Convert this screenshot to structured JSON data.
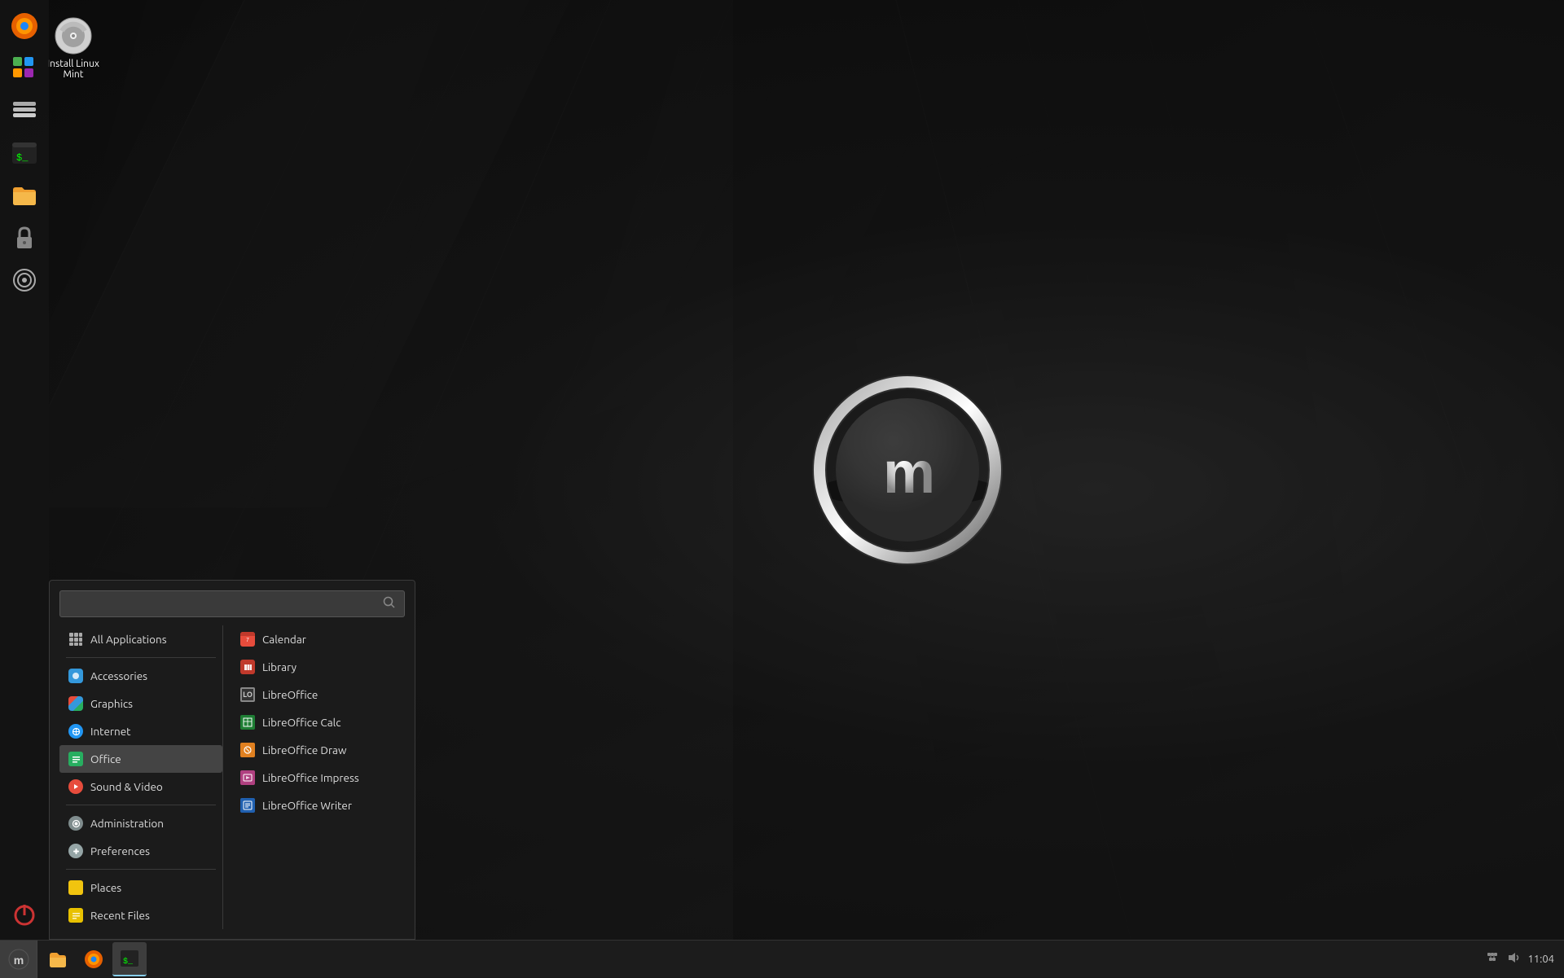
{
  "desktop": {
    "icon": {
      "label": "Install Linux Mint"
    }
  },
  "taskbar": {
    "time": "11:04",
    "start_label": "☰",
    "apps": [
      {
        "name": "files",
        "icon": "📁"
      },
      {
        "name": "firefox",
        "icon": "🦊"
      },
      {
        "name": "terminal",
        "icon": "⬛"
      }
    ]
  },
  "sidebar": {
    "icons": [
      {
        "name": "firefox",
        "icon": "🦊"
      },
      {
        "name": "grid-app",
        "icon": "⬛"
      },
      {
        "name": "stack",
        "icon": "⬛"
      },
      {
        "name": "terminal",
        "icon": "⬛"
      },
      {
        "name": "folder",
        "icon": "📁"
      },
      {
        "name": "lock",
        "icon": "🔒"
      },
      {
        "name": "gyro",
        "icon": "⬛"
      },
      {
        "name": "power",
        "icon": "⬛"
      }
    ]
  },
  "start_menu": {
    "search_placeholder": "",
    "left_items": [
      {
        "id": "all-apps",
        "label": "All Applications",
        "icon_type": "grid"
      },
      {
        "id": "accessories",
        "label": "Accessories",
        "icon_type": "blue"
      },
      {
        "id": "graphics",
        "label": "Graphics",
        "icon_type": "multi"
      },
      {
        "id": "internet",
        "label": "Internet",
        "icon_type": "blue-circle"
      },
      {
        "id": "office",
        "label": "Office",
        "icon_type": "green-sq",
        "active": true
      },
      {
        "id": "sound-video",
        "label": "Sound & Video",
        "icon_type": "red"
      },
      {
        "id": "administration",
        "label": "Administration",
        "icon_type": "gray"
      },
      {
        "id": "preferences",
        "label": "Preferences",
        "icon_type": "gray2"
      },
      {
        "id": "places",
        "label": "Places",
        "icon_type": "yellow"
      },
      {
        "id": "recent-files",
        "label": "Recent Files",
        "icon_type": "yellow2"
      }
    ],
    "right_items": [
      {
        "id": "calendar",
        "label": "Calendar",
        "icon_type": "red-sq"
      },
      {
        "id": "library",
        "label": "Library",
        "icon_type": "red-lib"
      },
      {
        "id": "libreoffice",
        "label": "LibreOffice",
        "icon_type": "lo-main"
      },
      {
        "id": "libreoffice-calc",
        "label": "LibreOffice Calc",
        "icon_type": "lo-calc"
      },
      {
        "id": "libreoffice-draw",
        "label": "LibreOffice Draw",
        "icon_type": "lo-draw"
      },
      {
        "id": "libreoffice-impress",
        "label": "LibreOffice Impress",
        "icon_type": "lo-impress"
      },
      {
        "id": "libreoffice-writer",
        "label": "LibreOffice Writer",
        "icon_type": "lo-writer"
      }
    ]
  }
}
